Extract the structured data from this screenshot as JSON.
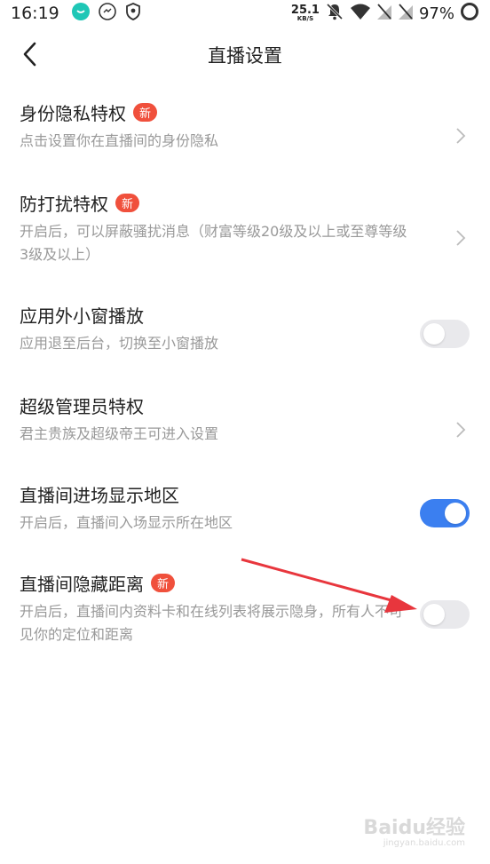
{
  "status_bar": {
    "time": "16:19",
    "net_speed_value": "25.1",
    "net_speed_unit": "KB/S",
    "battery_percent": "97%"
  },
  "header": {
    "title": "直播设置"
  },
  "settings": [
    {
      "title": "身份隐私特权",
      "badge": "新",
      "desc": "点击设置你在直播间的身份隐私",
      "control": "chevron"
    },
    {
      "title": "防打扰特权",
      "badge": "新",
      "desc": "开启后，可以屏蔽骚扰消息（财富等级20级及以上或至尊等级3级及以上）",
      "control": "chevron"
    },
    {
      "title": "应用外小窗播放",
      "badge": "",
      "desc": "应用退至后台，切换至小窗播放",
      "control": "toggle",
      "on": false
    },
    {
      "title": "超级管理员特权",
      "badge": "",
      "desc": "君主贵族及超级帝王可进入设置",
      "control": "chevron"
    },
    {
      "title": "直播间进场显示地区",
      "badge": "",
      "desc": "开启后，直播间入场显示所在地区",
      "control": "toggle",
      "on": true
    },
    {
      "title": "直播间隐藏距离",
      "badge": "新",
      "desc": "开启后，直播间内资料卡和在线列表将展示隐身，所有人不可见你的定位和距离",
      "control": "toggle",
      "on": false
    }
  ],
  "watermark": {
    "brand": "Baidu经验",
    "url": "jingyan.baidu.com"
  },
  "colors": {
    "accent": "#3b7ff0",
    "badge": "#f0503c",
    "arrow": "#e8363d",
    "toggle_off": "#e9e9ec"
  }
}
